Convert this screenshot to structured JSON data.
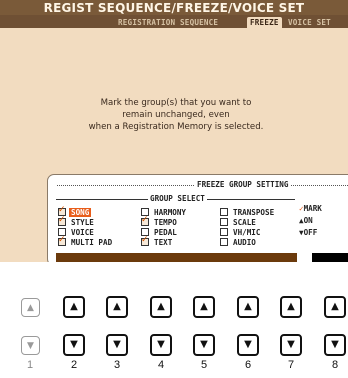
{
  "screen": {
    "title": "REGIST SEQUENCE/FREEZE/VOICE SET",
    "tabs": [
      {
        "label": "REGISTRATION SEQUENCE",
        "active": false
      },
      {
        "label": "FREEZE",
        "active": true
      },
      {
        "label": "VOICE SET",
        "active": false
      }
    ],
    "message_lines": [
      "Mark the group(s) that you want to",
      "remain unchanged, even",
      "when a Registration Memory is selected."
    ]
  },
  "panel": {
    "title": "FREEZE GROUP SETTING",
    "group_select_label": "GROUP SELECT",
    "items": [
      {
        "label": "SONG",
        "checked": true,
        "selected": true
      },
      {
        "label": "HARMONY",
        "checked": false,
        "selected": false
      },
      {
        "label": "TRANSPOSE",
        "checked": false,
        "selected": false
      },
      {
        "label": "STYLE",
        "checked": true,
        "selected": false
      },
      {
        "label": "TEMPO",
        "checked": true,
        "selected": false
      },
      {
        "label": "SCALE",
        "checked": false,
        "selected": false
      },
      {
        "label": "VOICE",
        "checked": false,
        "selected": false
      },
      {
        "label": "PEDAL",
        "checked": false,
        "selected": false
      },
      {
        "label": "VH/MIC",
        "checked": false,
        "selected": false
      },
      {
        "label": "MULTI PAD",
        "checked": true,
        "selected": false
      },
      {
        "label": "TEXT",
        "checked": true,
        "selected": false
      },
      {
        "label": "AUDIO",
        "checked": false,
        "selected": false
      }
    ],
    "mark_label": "MARK",
    "on_label": "ON",
    "off_label": "OFF",
    "nav_arrows": "▲▼",
    "nav_arrows_right": "▲▼"
  },
  "buttons": {
    "numbers": [
      "1",
      "2",
      "3",
      "4",
      "5",
      "6",
      "7",
      "8"
    ]
  },
  "colors": {
    "screen_bg": "#f2dcc0",
    "title_bar": "#7a5a39",
    "selection": "#e85d1a",
    "nav_bar": "#6b3a0c"
  }
}
